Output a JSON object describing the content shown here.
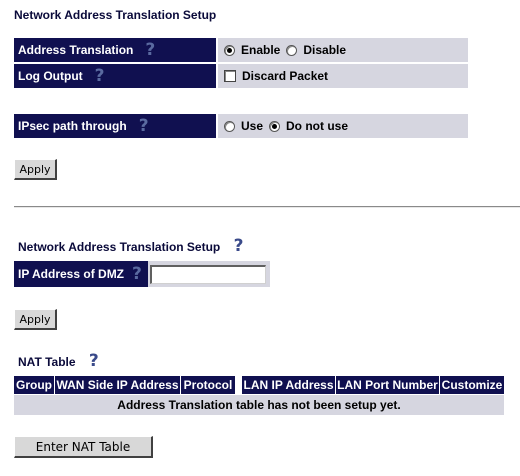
{
  "nat_setup": {
    "title": "Network Address Translation Setup",
    "address_translation": {
      "label": "Address Translation",
      "options": [
        "Enable",
        "Disable"
      ],
      "selected": "Enable"
    },
    "log_output": {
      "label": "Log Output",
      "checkbox_label": "Discard Packet",
      "checked": false
    },
    "ipsec": {
      "label": "IPsec path through",
      "options": [
        "Use",
        "Do not use"
      ],
      "selected": "Do not use"
    },
    "apply_label": "Apply"
  },
  "dmz": {
    "title": "Network Address Translation Setup",
    "label": "IP Address of DMZ",
    "value": "",
    "apply_label": "Apply"
  },
  "nat_table": {
    "title": "NAT Table",
    "columns": [
      "Group",
      "WAN Side IP Address",
      "Protocol",
      "LAN IP Address",
      "LAN Port Number",
      "Customize"
    ],
    "empty_message": "Address Translation table has not been setup yet.",
    "enter_button": "Enter NAT Table"
  },
  "icons": {
    "help": "help-question-icon"
  },
  "colors": {
    "header_bg": "#101050",
    "value_bg": "#d6d6e0",
    "help": "#5a6aa0"
  }
}
